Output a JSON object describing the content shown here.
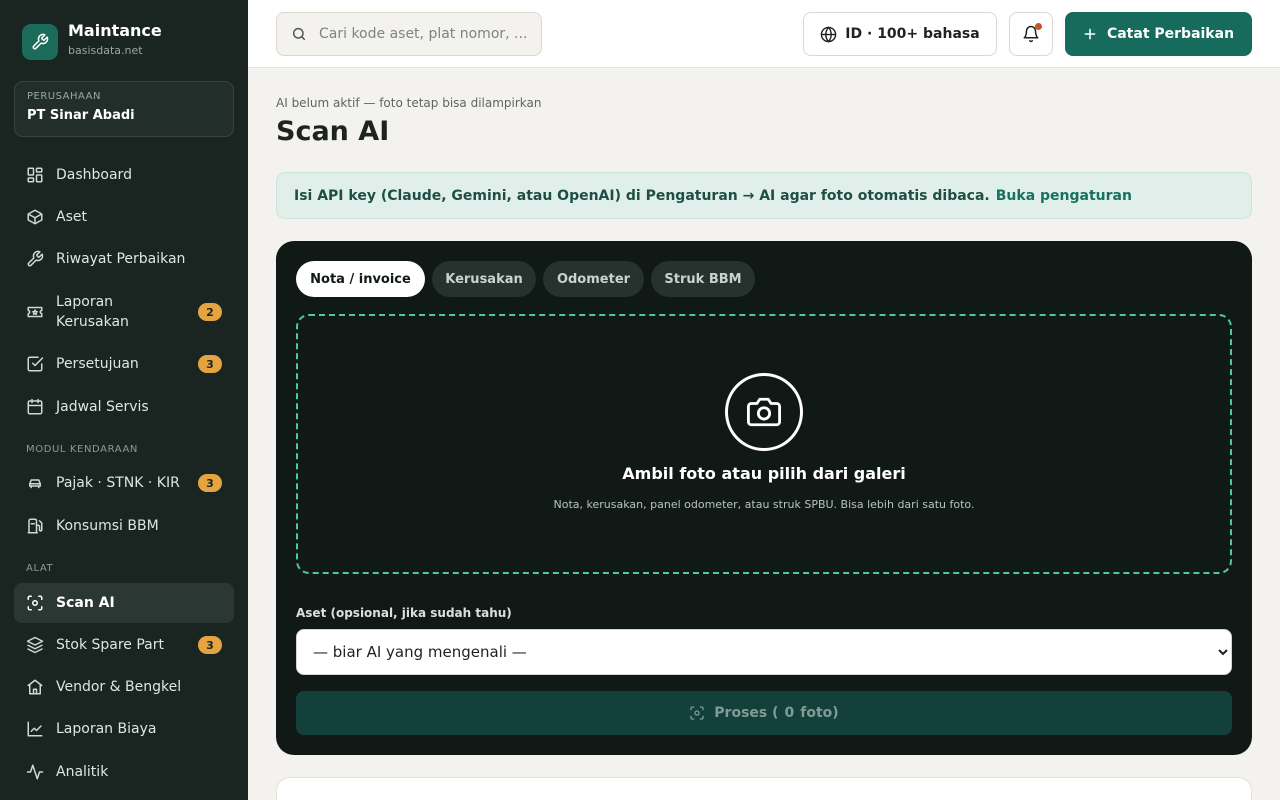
{
  "brand": {
    "name": "Maintance",
    "subtitle": "basisdata.net"
  },
  "company": {
    "label": "PERUSAHAAN",
    "name": "PT Sinar Abadi"
  },
  "sidebar": {
    "items": [
      {
        "label": "Dashboard",
        "icon": "dashboard-icon"
      },
      {
        "label": "Aset",
        "icon": "box-icon"
      },
      {
        "label": "Riwayat Perbaikan",
        "icon": "wrench-icon"
      },
      {
        "label": "Laporan Kerusakan",
        "icon": "ticket-icon",
        "badge": "2"
      },
      {
        "label": "Persetujuan",
        "icon": "check-square-icon",
        "badge": "3"
      },
      {
        "label": "Jadwal Servis",
        "icon": "calendar-icon"
      }
    ],
    "section_vehicle": "MODUL KENDARAAN",
    "vehicle_items": [
      {
        "label": "Pajak · STNK · KIR",
        "icon": "car-icon",
        "badge": "3"
      },
      {
        "label": "Konsumsi BBM",
        "icon": "fuel-icon"
      }
    ],
    "section_tools": "ALAT",
    "tool_items": [
      {
        "label": "Scan AI",
        "icon": "scan-icon",
        "active": true
      },
      {
        "label": "Stok Spare Part",
        "icon": "layers-icon",
        "badge": "3"
      },
      {
        "label": "Vendor & Bengkel",
        "icon": "store-icon"
      },
      {
        "label": "Laporan Biaya",
        "icon": "chart-icon"
      },
      {
        "label": "Analitik",
        "icon": "activity-icon"
      }
    ]
  },
  "header": {
    "search_placeholder": "Cari kode aset, plat nomor, ...",
    "language_label": "ID · 100+ bahasa",
    "primary_button": "Catat Perbaikan",
    "notification_unread": true
  },
  "page": {
    "breadcrumb": "AI belum aktif — foto tetap bisa dilampirkan",
    "title": "Scan AI",
    "alert_text": "Isi API key (Claude, Gemini, atau OpenAI) di Pengaturan → AI agar foto otomatis dibaca.",
    "alert_link": "Buka pengaturan"
  },
  "scan": {
    "tabs": [
      "Nota / invoice",
      "Kerusakan",
      "Odometer",
      "Struk BBM"
    ],
    "active_tab": 0,
    "dropzone_title": "Ambil foto atau pilih dari galeri",
    "dropzone_subtitle": "Nota, kerusakan, panel odometer, atau struk SPBU. Bisa lebih dari satu foto.",
    "asset_label": "Aset (opsional, jika sudah tahu)",
    "asset_selected": "— biar AI yang mengenali —",
    "process_prefix": "Proses (",
    "photo_count": "0",
    "process_suffix": "foto)"
  },
  "colors": {
    "sidebar_bg": "#1a2420",
    "accent": "#176b5c",
    "badge": "#e6a440",
    "card_bg": "#111917",
    "dashed_border": "#4fc7a7",
    "notification_dot": "#c8522b"
  }
}
